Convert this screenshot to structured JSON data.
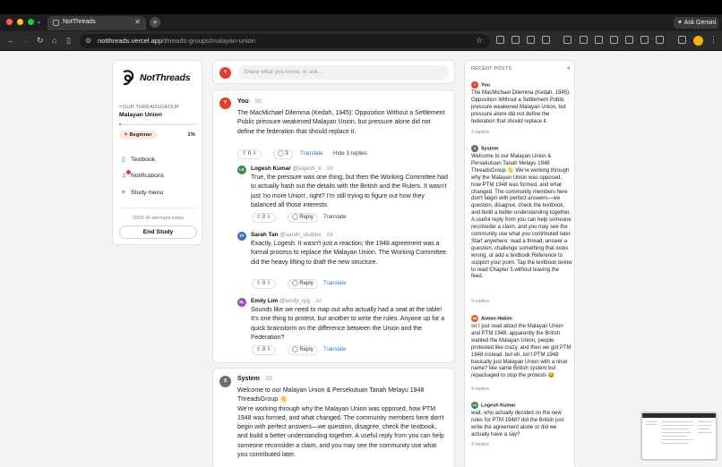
{
  "browser": {
    "tab_title": "NotThreads",
    "url_host": "notthreads.vercel.app",
    "url_path": "/threads-groups/malayan-union",
    "ask_button": "Ask Gemini"
  },
  "sidebar": {
    "logo_text": "NotThreads",
    "section_label": "YOUR THREADSGROUP",
    "group_name": "Malayan Union",
    "progress_fraction": 0.01,
    "level_badge": "Beginner",
    "progress_percent": "1%",
    "nav": [
      {
        "label": "Textbook",
        "icon": "book-icon"
      },
      {
        "label": "Notifications",
        "icon": "bell-icon"
      },
      {
        "label": "Study menu",
        "icon": "menu-icon"
      }
    ],
    "attempts": "20/20 AI attempts today",
    "end_button": "End Study"
  },
  "composer": {
    "avatar": "Y",
    "placeholder": "Share what you know, or ask..."
  },
  "main_post": {
    "avatar": "Y",
    "author": "You",
    "time": "· 3d",
    "body": "The MacMichael Dilemma (Kedah, 1945): Opposition Without a Settlement\nPublic pressure weakened Malayan Union, but pressure alone did not define the federation that should replace it.",
    "votes": "0",
    "reply_count": "3",
    "translate": "Translate",
    "hide_replies": "Hide 3 replies"
  },
  "replies": [
    {
      "avatar": "LK",
      "author": "Logesh Kumar",
      "handle": "@logesh_k",
      "time": "· 3d",
      "body": "True, the pressure was one thing, but then the Working Committee had to actually hash out the details with the British and the Rulers. It wasn't just 'no more Union', right? I'm still trying to figure out how they balanced all those interests.",
      "votes": "0",
      "reply": "Reply",
      "translate": "Translate"
    },
    {
      "avatar": "ST",
      "author": "Sarah Tan",
      "handle": "@sarah_studies",
      "time": "· 3d",
      "body": "Exactly, Logesh. It wasn't just a reaction; the 1948 agreement was a formal process to replace the Malayan Union. The Working Committee did the heavy lifting to draft the new structure.",
      "votes": "0",
      "reply": "Reply",
      "translate": "Translate"
    },
    {
      "avatar": "EL",
      "author": "Emily Lim",
      "handle": "@emily_rpg",
      "time": "· 3d",
      "body": "Sounds like we need to map out who actually had a seat at the table! It's one thing to protest, but another to write the rules. Anyone up for a quick brainstorm on the difference between the Union and the Federation?",
      "votes": "0",
      "reply": "Reply",
      "translate": "Translate"
    }
  ],
  "system_post": {
    "avatar": "S",
    "author": "System",
    "time": "· 3d",
    "body": "Welcome to our Malayan Union & Persekutuan Tanah Melayu 1948 ThreadsGroup 👋\nWe're working through why the Malayan Union was opposed, how PTM 1948 was formed, and what changed. The community members here don't begin with perfect answers—we question, disagree, check the textbook, and build a better understanding together. A useful reply from you can help someone reconsider a claim, and you may see the community use what you contributed later."
  },
  "recent": {
    "heading": "RECENT POSTS",
    "count": "4",
    "posts": [
      {
        "avatar": "Y",
        "author": "You",
        "text": "The MacMichael Dilemma (Kedah, 1945): Opposition Without a Settlement Public pressure weakened Malayan Union, but pressure alone did not define the federation that should replace it.",
        "replies": "3 replies"
      },
      {
        "avatar": "S",
        "author": "System",
        "text": "Welcome to our Malayan Union & Persekutuan Tanah Melayu 1948 ThreadsGroup 👋 We're working through why the Malayan Union was opposed, how PTM 1948 was formed, and what changed. The community members here don't begin with perfect answers—we question, disagree, check the textbook, and build a better understanding together. A useful reply from you can help someone reconsider a claim, and you may see the community use what you contributed later. Start anywhere: read a thread, answer a question, challenge something that looks wrong, or add a textbook Reference to support your point. Tap the textbook below to read Chapter 5 without leaving the feed.",
        "replies": "0 replies"
      },
      {
        "avatar": "AH",
        "author": "Aiman Hakim",
        "text": "so I just read about the Malayan Union and PTM 1948. apparently the British wanted the Malayan Union, people protested like crazy, and then we got PTM 1948 instead. but eh, isn't PTM 1948 basically just Malayan Union with a nicer name? like same British system but repackaged to stop the protests 😂",
        "replies": "4 replies"
      },
      {
        "avatar": "LK",
        "author": "Logesh Kumar",
        "text": "wait, who actually decided on the new rules for PTM 1948? did the British just write the agreement alone or did we actually have a say?",
        "replies": "3 replies"
      }
    ]
  }
}
